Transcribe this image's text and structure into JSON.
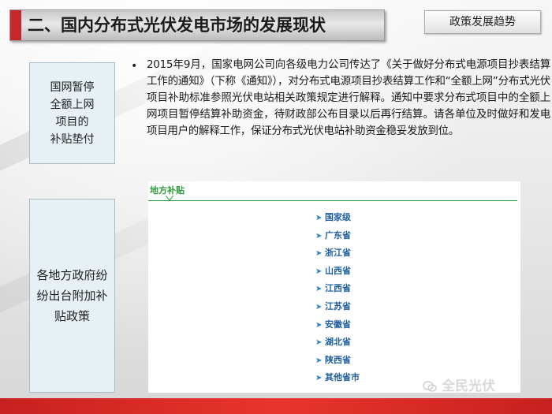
{
  "slide": {
    "title": "二、国内分布式光伏发电市场的发展现状",
    "tag": "政策发展趋势",
    "side_boxes": [
      {
        "lines": [
          "国网暂停",
          "全额上网",
          "项目的",
          "补贴垫付"
        ]
      },
      {
        "lines": [
          "各地方政府纷",
          "纷出台附加补",
          "贴政策"
        ]
      }
    ],
    "bullet_symbol": "•",
    "paragraph": "2015年9月，国家电网公司向各级电力公司传达了《关于做好分布式电源项目抄表结算工作的通知》（下称《通知》），对分布式电源项目抄表结算工作和“全额上网”分布式光伏项目补助标准参照光伏电站相关政策规定进行解释。通知中要求分布式项目中的全额上网项目暂停结算补助资金，待财政部公布目录以后再行结算。请各单位及时做好和发电项目用户的解释工作，保证分布式光伏电站补助资金稳妥发放到位。",
    "sub_panel": {
      "title": "地方补贴",
      "items": [
        "国家级",
        "广东省",
        "浙江省",
        "山西省",
        "江西省",
        "江苏省",
        "安徽省",
        "湖北省",
        "陕西省",
        "其他省市"
      ]
    },
    "watermark": "全民光伏"
  },
  "colors": {
    "accent_red": "#c4282b",
    "panel_green": "#2e9a3a",
    "list_blue": "#1f5f9e",
    "side_box_bg": "#e6f0f5"
  }
}
